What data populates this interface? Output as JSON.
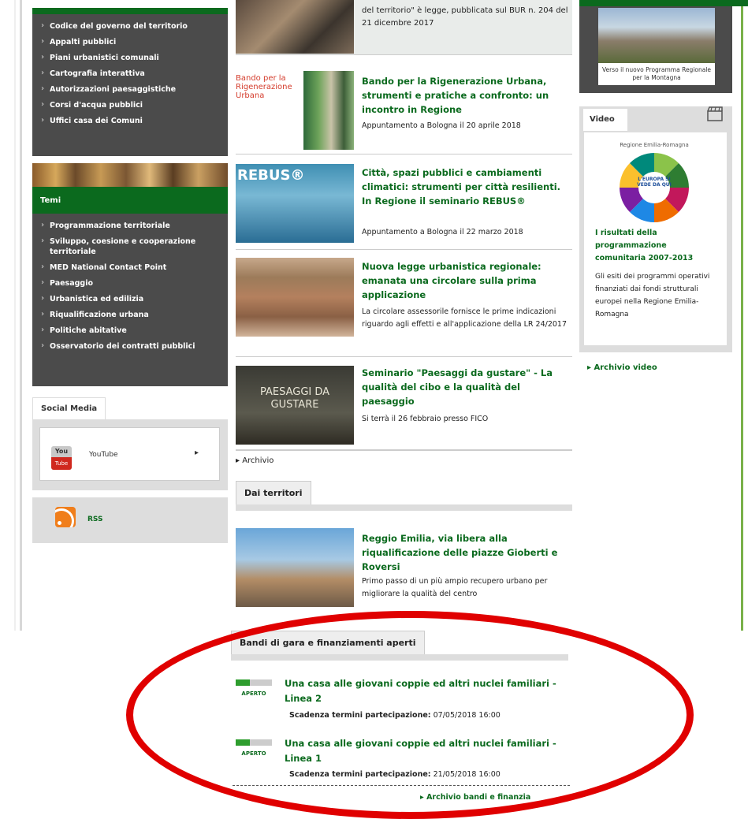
{
  "left_menu_1": [
    "Codice del governo del territorio",
    "Appalti pubblici",
    "Piani urbanistici comunali",
    "Cartografia interattiva",
    "Autorizzazioni paesaggistiche",
    "Corsi d'acqua pubblici",
    "Uffici casa dei Comuni"
  ],
  "temi": {
    "title": "Temi",
    "items": [
      "Programmazione territoriale",
      "Sviluppo, coesione e cooperazione territoriale",
      "MED National Contact Point",
      "Paesaggio",
      "Urbanistica ed edilizia",
      "Riqualificazione urbana",
      "Politiche abitative",
      "Osservatorio dei contratti pubblici"
    ]
  },
  "social": {
    "title": "Social Media",
    "youtube_label": "YouTube",
    "youtube_icon_top": "You",
    "youtube_icon_bottom": "Tube",
    "rss_label": "RSS"
  },
  "news": [
    {
      "title": "",
      "desc": "del territorio\" è legge, pubblicata sul BUR n. 204 del 21 dicembre 2017"
    },
    {
      "title": "Bando per la Rigenerazione Urbana, strumenti e pratiche a confronto: un incontro in Regione",
      "desc": "Appuntamento a Bologna il 20 aprile 2018",
      "thumb_text": "Bando per la Rigenerazione Urbana"
    },
    {
      "title": "Città, spazi pubblici e cambiamenti climatici: strumenti per città resilienti. In Regione il seminario REBUS®",
      "desc": "Appuntamento a Bologna il 22 marzo 2018",
      "thumb_text": "REBUS®"
    },
    {
      "title": "Nuova legge urbanistica regionale: emanata una circolare sulla prima applicazione",
      "desc": "La circolare assessorile fornisce le prime indicazioni riguardo agli effetti e all'applicazione della LR 24/2017"
    },
    {
      "title": "Seminario \"Paesaggi da gustare\" - La qualità del cibo e la qualità del paesaggio",
      "desc": "Si terrà il 26 febbraio presso FICO",
      "thumb_text": "PAESAGGI DA GUSTARE"
    }
  ],
  "archivio": "Archivio",
  "dal_territori": {
    "title": "Dai territori",
    "item_title": "Reggio Emilia, via libera alla riqualificazione delle piazze Gioberti e Roversi",
    "item_desc": "Primo passo di un più ampio recupero urbano per migliorare la qualità del centro"
  },
  "bandi": {
    "title": "Bandi di gara e finanziamenti aperti",
    "date_label": "Scadenza termini partecipazione:",
    "status": "APERTO",
    "items": [
      {
        "title": "Una casa alle giovani coppie ed altri nuclei familiari - Linea 2",
        "date": "07/05/2018 16:00",
        "progress": 0.4
      },
      {
        "title": "Una casa alle giovani coppie ed altri nuclei familiari - Linea 1",
        "date": "21/05/2018 16:00",
        "progress": 0.4
      }
    ],
    "archive_link": "Archivio bandi e finanzia"
  },
  "right": {
    "banner_caption": "Verso il nuovo Programma Regionale per la Montagna",
    "video_tab": "Video",
    "video_img_header": "Regione Emilia-Romagna",
    "video_img_text": "L'EUROPA SI VEDE DA QUI",
    "video_title": "I risultati della programmazione comunitaria 2007-2013",
    "video_desc": "Gli esiti dei programmi operativi finanziati dai fondi strutturali europei nella Regione Emilia-Romagna",
    "archive_video": "Archivio video"
  },
  "colors": {
    "green": "#0b6a1e",
    "menu_bg": "#4b4b4b",
    "highlight": "#e00000"
  }
}
